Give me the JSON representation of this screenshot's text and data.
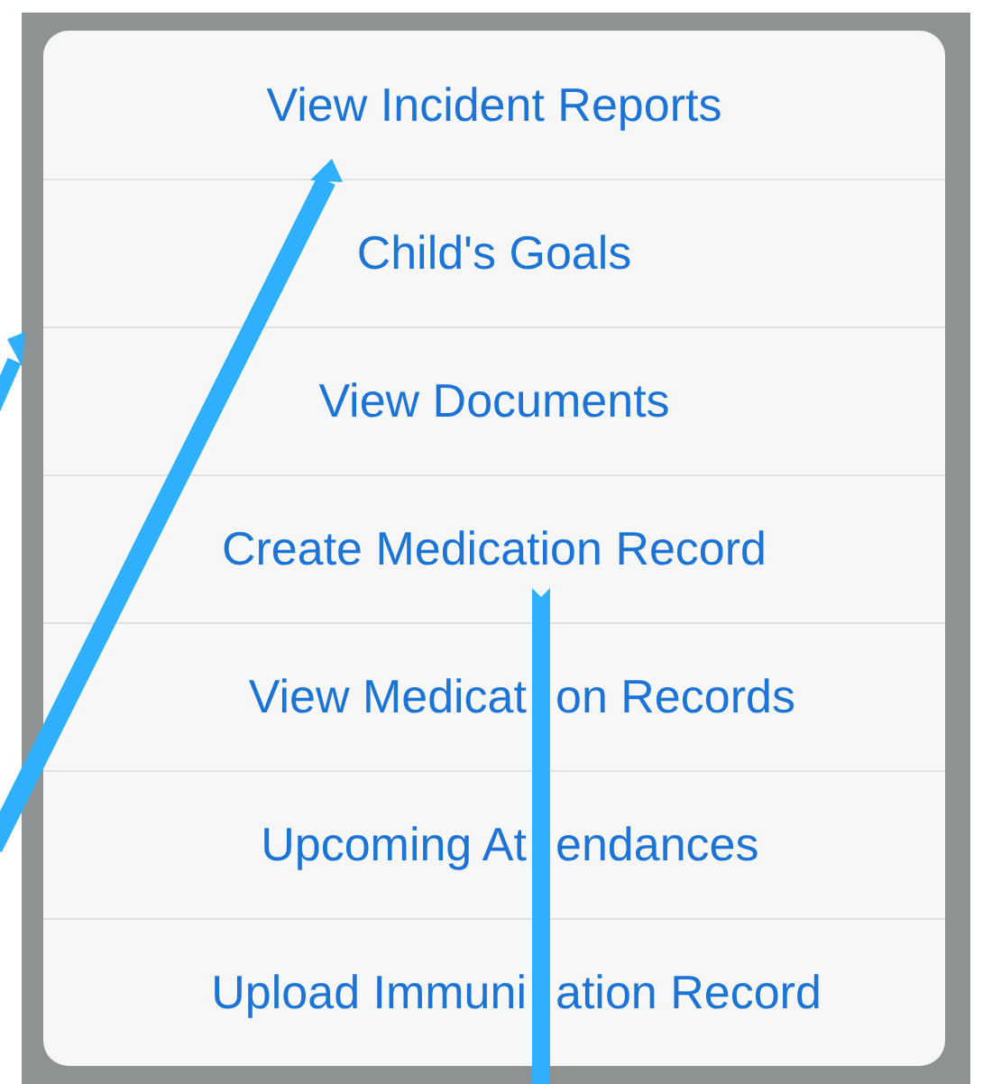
{
  "action_sheet": {
    "items": [
      {
        "segments": [
          "View Incident Reports"
        ]
      },
      {
        "segments": [
          "Child's Goals"
        ]
      },
      {
        "segments": [
          "View Documents"
        ]
      },
      {
        "segments": [
          "Create Medication Record"
        ]
      },
      {
        "segments": [
          "View Medicat",
          "on Records"
        ]
      },
      {
        "segments": [
          "Upcoming At",
          "endances"
        ]
      },
      {
        "segments": [
          "Upload Immuni",
          "ation Record"
        ]
      }
    ]
  }
}
